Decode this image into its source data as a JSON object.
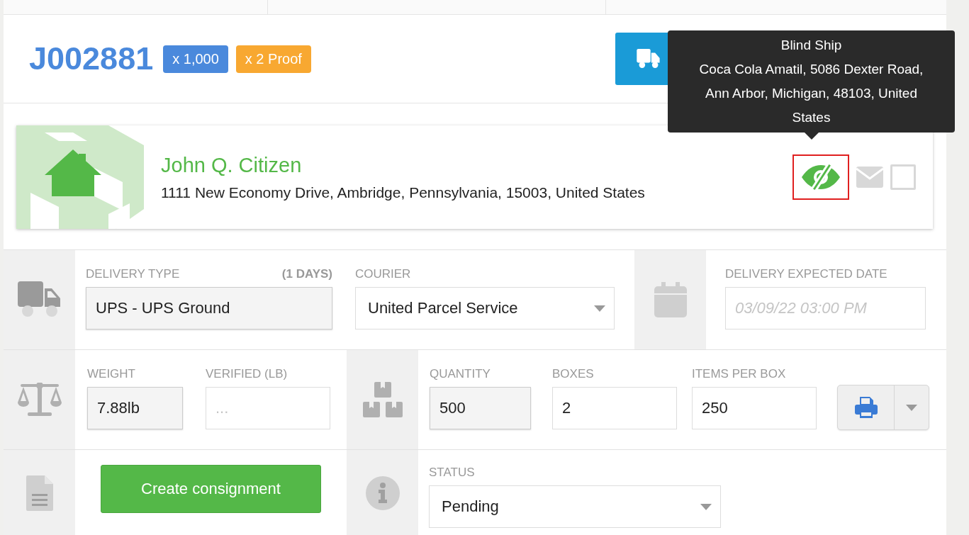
{
  "job": {
    "number": "J002881",
    "badges": [
      {
        "text": "x 1,000",
        "color": "#4a89dc"
      },
      {
        "text": "x 2 Proof",
        "color": "#f8a831"
      }
    ]
  },
  "tooltip": {
    "title": "Blind Ship",
    "text": "Coca Cola Amatil, 5086 Dexter Road, Ann Arbor, Michigan, 48103, United States"
  },
  "address": {
    "name": "John Q. Citizen",
    "line": "1111 New Economy Drive, Ambridge, Pennsylvania, 15003, United States",
    "blind_ship": true,
    "checked": false
  },
  "delivery_type": {
    "label": "DELIVERY TYPE",
    "days": "(1 DAYS)",
    "value": "UPS - UPS Ground",
    "readonly": true
  },
  "courier": {
    "label": "COURIER",
    "value": "United Parcel Service"
  },
  "expected_date": {
    "label": "DELIVERY EXPECTED DATE",
    "placeholder": "03/09/22 03:00 PM"
  },
  "weight": {
    "label": "WEIGHT",
    "value": "7.88lb",
    "readonly": true
  },
  "verified": {
    "label": "VERIFIED (LB)",
    "placeholder": "..."
  },
  "quantity": {
    "label": "QUANTITY",
    "value": "500",
    "readonly": true
  },
  "boxes": {
    "label": "BOXES",
    "value": "2",
    "readonly": false
  },
  "items_per_box": {
    "label": "ITEMS PER BOX",
    "value": "250",
    "readonly": false
  },
  "create_button": "Create consignment",
  "status": {
    "label": "STATUS",
    "value": "Pending"
  }
}
